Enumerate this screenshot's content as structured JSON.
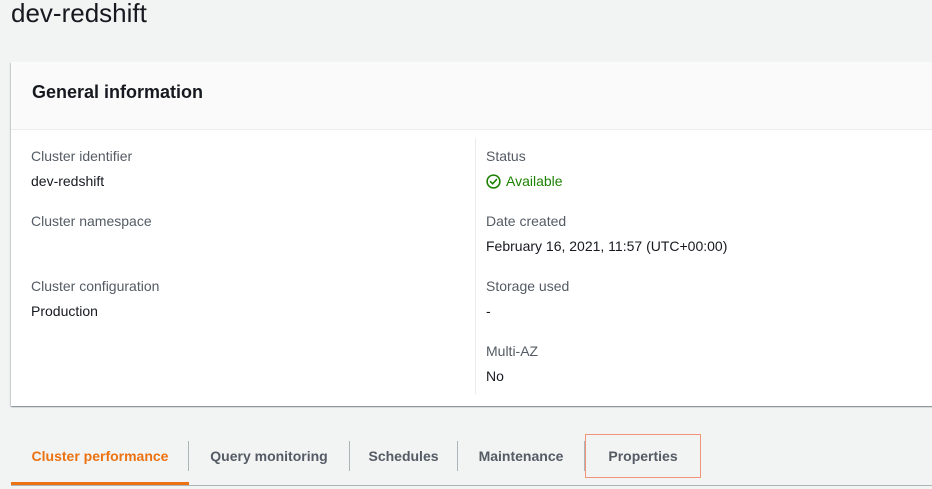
{
  "page": {
    "title": "dev-redshift"
  },
  "general_info": {
    "heading": "General information",
    "left": [
      {
        "label": "Cluster identifier",
        "value": "dev-redshift"
      },
      {
        "label": "Cluster namespace",
        "value": ""
      },
      {
        "label": "Cluster configuration",
        "value": "Production"
      }
    ],
    "right": [
      {
        "label": "Status",
        "value": "Available",
        "status_color": "#1d8102",
        "icon": "check-circle-icon"
      },
      {
        "label": "Date created",
        "value": "February 16, 2021, 11:57 (UTC+00:00)"
      },
      {
        "label": "Storage used",
        "value": "-"
      },
      {
        "label": "Multi-AZ",
        "value": "No"
      }
    ]
  },
  "tabs": [
    {
      "label": "Cluster performance",
      "active": true
    },
    {
      "label": "Query monitoring",
      "active": false
    },
    {
      "label": "Schedules",
      "active": false
    },
    {
      "label": "Maintenance",
      "active": false
    },
    {
      "label": "Properties",
      "active": false,
      "highlighted": true
    }
  ],
  "colors": {
    "accent": "#ec7211",
    "success": "#1d8102",
    "highlight_border": "#f2937c"
  }
}
